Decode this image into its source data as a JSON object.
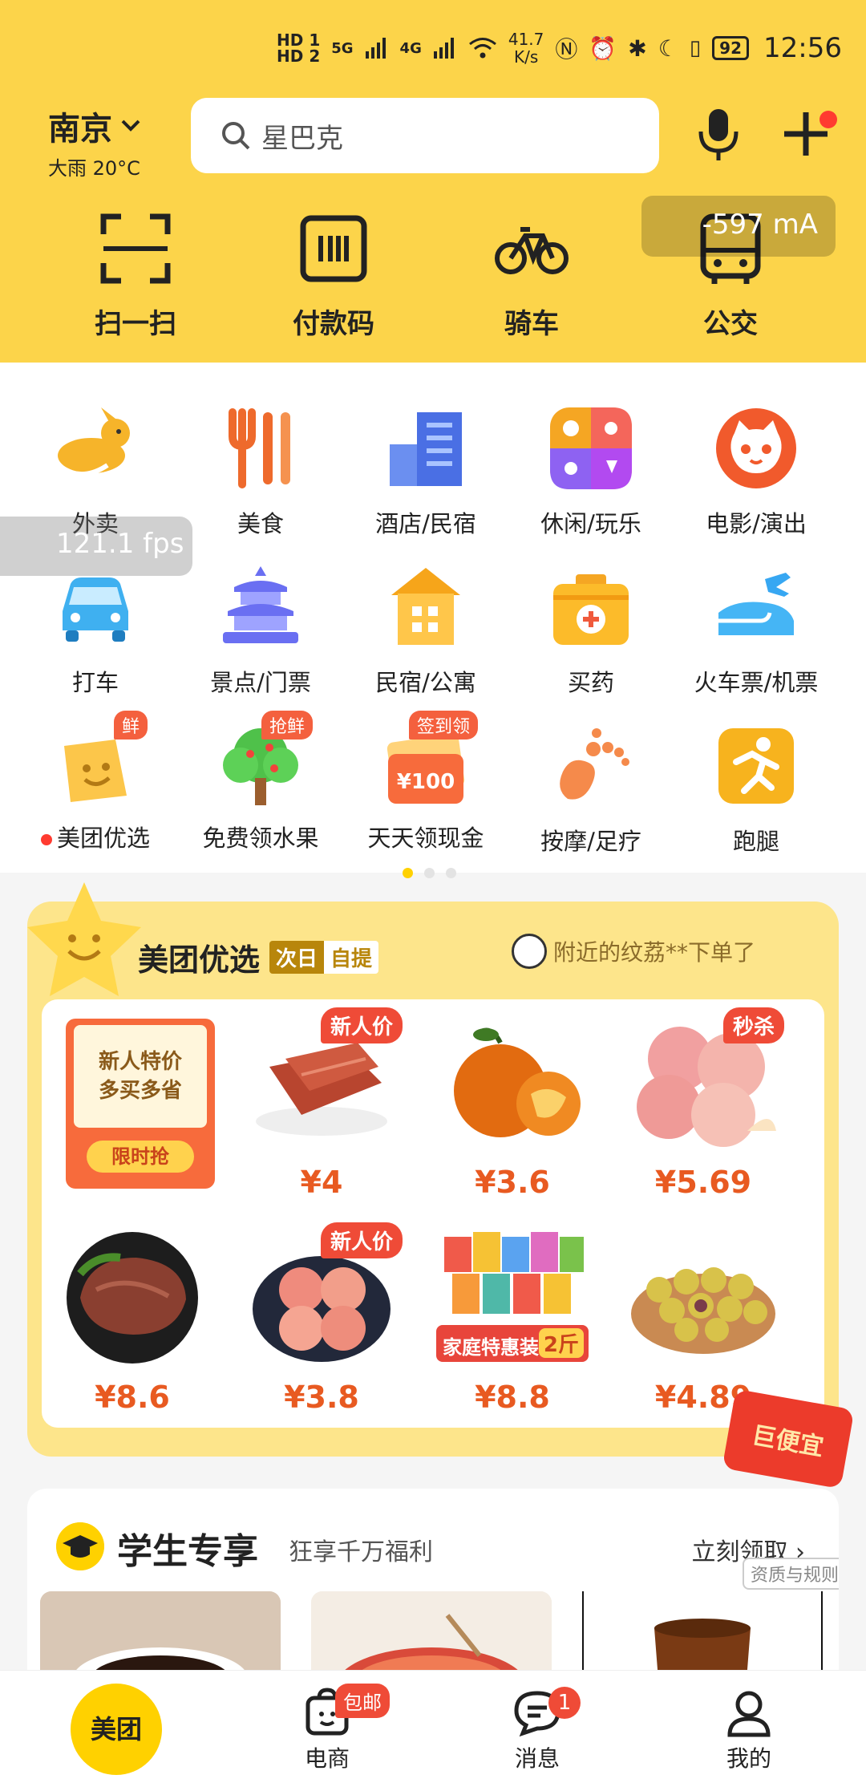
{
  "status_bar": {
    "sim1": "HD 1",
    "sim2": "HD 2",
    "net1": "5G",
    "net2": "4G",
    "speed_value": "41.7",
    "speed_unit": "K/s",
    "battery": "92",
    "time": "12:56"
  },
  "header": {
    "city": "南京",
    "weather": "大雨 20°C",
    "search_placeholder": "星巴克"
  },
  "quick_actions": [
    {
      "label": "扫一扫",
      "icon": "scan-icon"
    },
    {
      "label": "付款码",
      "icon": "barcode-icon"
    },
    {
      "label": "骑车",
      "icon": "bicycle-icon"
    },
    {
      "label": "公交",
      "icon": "bus-icon"
    }
  ],
  "overlay": {
    "current": "-597 mA",
    "fps": "121.1 fps"
  },
  "services": [
    {
      "label": "外卖",
      "icon": "kangaroo-icon"
    },
    {
      "label": "美食",
      "icon": "fork-knife-icon"
    },
    {
      "label": "酒店/民宿",
      "icon": "hotel-icon"
    },
    {
      "label": "休闲/玩乐",
      "icon": "leisure-icon"
    },
    {
      "label": "电影/演出",
      "icon": "cat-face-icon"
    },
    {
      "label": "打车",
      "icon": "car-icon"
    },
    {
      "label": "景点/门票",
      "icon": "temple-icon"
    },
    {
      "label": "民宿/公寓",
      "icon": "house-icon"
    },
    {
      "label": "买药",
      "icon": "medicine-box-icon"
    },
    {
      "label": "火车票/机票",
      "icon": "train-plane-icon"
    },
    {
      "label": "美团优选",
      "icon": "smile-bag-icon",
      "tag": "鲜"
    },
    {
      "label": "免费领水果",
      "icon": "tree-icon",
      "tag": "抢鲜"
    },
    {
      "label": "天天领现金",
      "icon": "cash-icon",
      "tag": "签到领",
      "inner": "¥100"
    },
    {
      "label": "按摩/足疗",
      "icon": "foot-icon"
    },
    {
      "label": "跑腿",
      "icon": "runner-icon"
    }
  ],
  "youxuan": {
    "title": "美团优选",
    "tag1": "次日",
    "tag2": "自提",
    "ticker": "附近的纹荔**下单了",
    "promo_line1": "新人特价",
    "promo_line2": "多买多省",
    "promo_button": "限时抢",
    "products": [
      {
        "price": "¥4",
        "badge": "新人价",
        "icon": "jerky-icon"
      },
      {
        "price": "¥3.6",
        "badge": "",
        "icon": "orange-icon"
      },
      {
        "price": "¥5.69",
        "badge": "秒杀",
        "icon": "peach-icon"
      },
      {
        "price": "¥8.6",
        "badge": "",
        "icon": "beef-icon"
      },
      {
        "price": "¥3.8",
        "badge": "新人价",
        "icon": "peach-bowl-icon"
      },
      {
        "price": "¥8.8",
        "badge": "",
        "icon": "snacks-icon",
        "caption": "家庭特惠装",
        "caption2": "2斤"
      },
      {
        "price": "¥4.89",
        "badge": "",
        "icon": "longan-icon"
      }
    ],
    "float_badge": "巨便宜"
  },
  "student": {
    "title": "学生专享",
    "subtitle": "狂享千万福利",
    "action": "立刻领取",
    "rules": "资质与规则"
  },
  "bottom_nav": [
    {
      "label": "美团",
      "icon": "home-icon"
    },
    {
      "label": "电商",
      "icon": "shop-icon",
      "pill": "包邮"
    },
    {
      "label": "消息",
      "icon": "chat-icon",
      "count": "1"
    },
    {
      "label": "我的",
      "icon": "profile-icon"
    }
  ]
}
